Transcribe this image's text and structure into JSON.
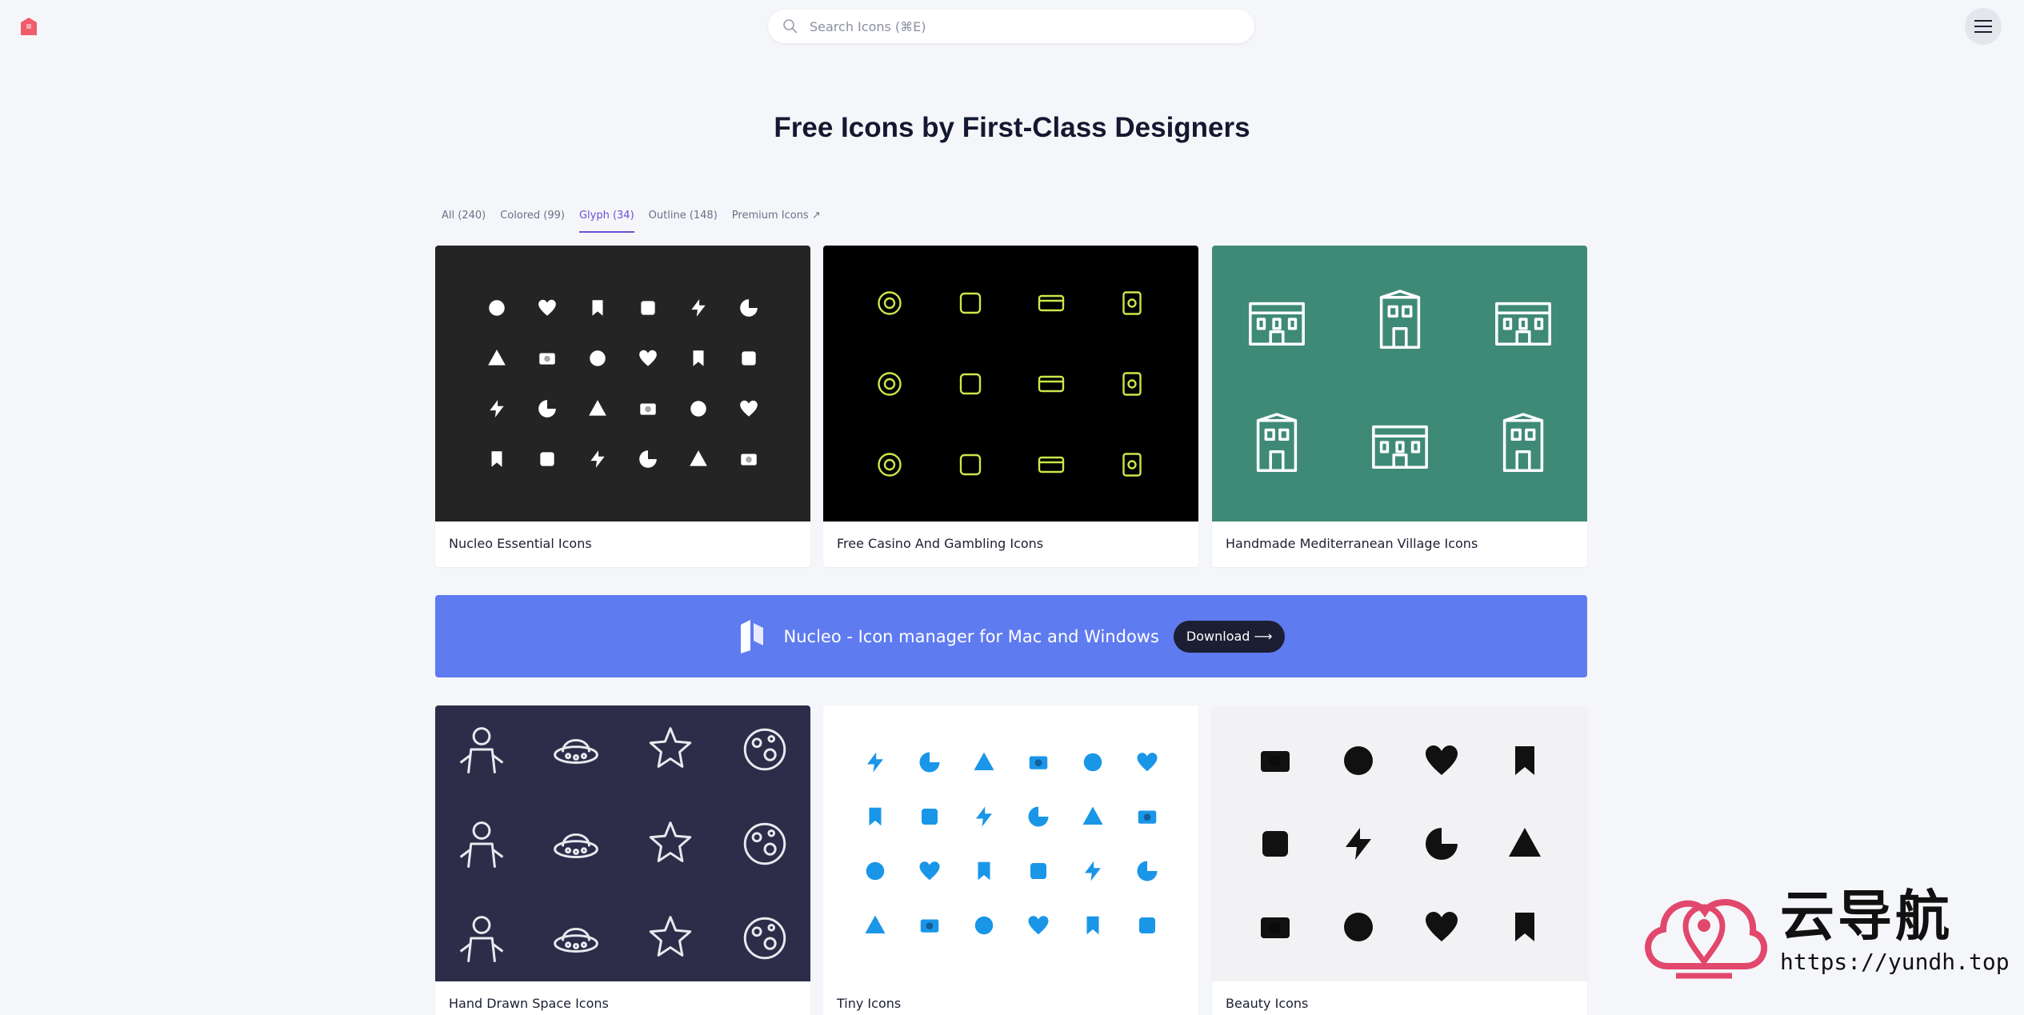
{
  "search": {
    "placeholder": "Search Icons (⌘E)"
  },
  "page_title": "Free Icons by First-Class Designers",
  "tabs": [
    {
      "label": "All (240)"
    },
    {
      "label": "Colored (99)"
    },
    {
      "label": "Glyph (34)",
      "active": true
    },
    {
      "label": "Outline (148)"
    },
    {
      "label": "Premium Icons ↗"
    }
  ],
  "cards": [
    {
      "name": "Nucleo Essential Icons",
      "bg": "#242424",
      "icon_color": "#ffffff"
    },
    {
      "name": "Free Casino And Gambling Icons",
      "bg": "#000000",
      "icon_color": "#c9e84a"
    },
    {
      "name": "Handmade Mediterranean Village Icons",
      "bg": "#3f8a77",
      "icon_color": "#ffffff"
    },
    {
      "name": "Hand Drawn Space Icons",
      "bg": "#2d2d4a",
      "icon_color": "#e9e9ef"
    },
    {
      "name": "Tiny Icons",
      "bg": "#ffffff",
      "icon_color": "#1a96e8"
    },
    {
      "name": "Beauty Icons",
      "bg": "#f2f2f4",
      "icon_color": "#111111"
    }
  ],
  "banner": {
    "text": "Nucleo - Icon manager for Mac and Windows",
    "button": "Download ⟶",
    "bg": "#5f7bf0"
  },
  "watermark": {
    "cn": "云导航",
    "url": "https://yundh.top"
  },
  "colors": {
    "accent": "#6b4fd8",
    "logo": "#ef5d6b"
  }
}
